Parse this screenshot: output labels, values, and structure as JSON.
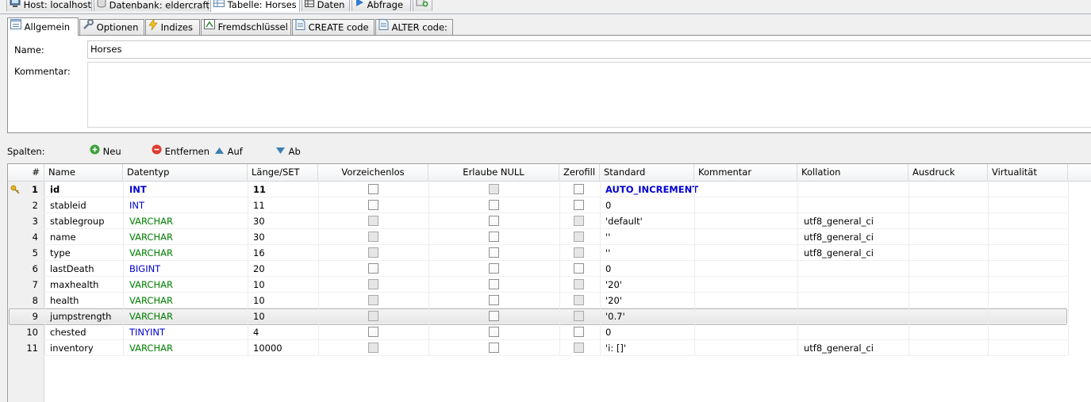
{
  "top_tabs": [
    {
      "label": "Host: localhost",
      "icon": "server-icon"
    },
    {
      "label": "Datenbank: eldercraft",
      "icon": "database-icon"
    },
    {
      "label": "Tabelle: Horses",
      "icon": "table-icon",
      "active": true
    },
    {
      "label": "Daten",
      "icon": "data-grid-icon"
    },
    {
      "label": "Abfrage",
      "icon": "play-query-icon"
    },
    {
      "label": "",
      "icon": "new-query-tab-icon"
    }
  ],
  "inner_tabs": [
    {
      "label": "Allgemein",
      "icon": "general-icon",
      "active": true
    },
    {
      "label": "Optionen",
      "icon": "wrench-icon"
    },
    {
      "label": "Indizes",
      "icon": "lightning-icon"
    },
    {
      "label": "Fremdschlüssel",
      "icon": "foreign-key-icon"
    },
    {
      "label": "CREATE code",
      "icon": "code-page-icon"
    },
    {
      "label": "ALTER code:",
      "icon": "code-page-icon"
    }
  ],
  "general": {
    "name_label": "Name:",
    "name_value": "Horses",
    "comment_label": "Kommentar:",
    "comment_value": ""
  },
  "columns_toolbar": {
    "label": "Spalten:",
    "new": "Neu",
    "remove": "Entfernen",
    "up": "Auf",
    "down": "Ab"
  },
  "grid": {
    "headers": [
      "#",
      "Name",
      "Datentyp",
      "Länge/SET",
      "Vorzeichenlos",
      "Erlaube NULL",
      "Zerofill",
      "Standard",
      "Kommentar",
      "Kollation",
      "Ausdruck",
      "Virtualität"
    ],
    "rows": [
      {
        "num": "1",
        "name": "id",
        "type": "INT",
        "length": "11",
        "unsigned": false,
        "allow_null": false,
        "zerofill": false,
        "default": "AUTO_INCREMENT",
        "comment": "",
        "collation": "",
        "primary_key": true
      },
      {
        "num": "2",
        "name": "stableid",
        "type": "INT",
        "length": "11",
        "unsigned": false,
        "allow_null": false,
        "zerofill": false,
        "default": "0",
        "comment": "",
        "collation": ""
      },
      {
        "num": "3",
        "name": "stablegroup",
        "type": "VARCHAR",
        "length": "30",
        "unsigned": false,
        "allow_null": false,
        "zerofill": false,
        "default": "'default'",
        "comment": "",
        "collation": "utf8_general_ci"
      },
      {
        "num": "4",
        "name": "name",
        "type": "VARCHAR",
        "length": "30",
        "unsigned": false,
        "allow_null": false,
        "zerofill": false,
        "default": "''",
        "comment": "",
        "collation": "utf8_general_ci"
      },
      {
        "num": "5",
        "name": "type",
        "type": "VARCHAR",
        "length": "16",
        "unsigned": false,
        "allow_null": false,
        "zerofill": false,
        "default": "''",
        "comment": "",
        "collation": "utf8_general_ci"
      },
      {
        "num": "6",
        "name": "lastDeath",
        "type": "BIGINT",
        "length": "20",
        "unsigned": false,
        "allow_null": false,
        "zerofill": false,
        "default": "0",
        "comment": "",
        "collation": ""
      },
      {
        "num": "7",
        "name": "maxhealth",
        "type": "VARCHAR",
        "length": "10",
        "unsigned": false,
        "allow_null": false,
        "zerofill": false,
        "default": "'20'",
        "comment": "",
        "collation": ""
      },
      {
        "num": "8",
        "name": "health",
        "type": "VARCHAR",
        "length": "10",
        "unsigned": false,
        "allow_null": false,
        "zerofill": false,
        "default": "'20'",
        "comment": "",
        "collation": ""
      },
      {
        "num": "9",
        "name": "jumpstrength",
        "type": "VARCHAR",
        "length": "10",
        "unsigned": false,
        "allow_null": false,
        "zerofill": false,
        "default": "'0.7'",
        "comment": "",
        "collation": "",
        "selected": true
      },
      {
        "num": "10",
        "name": "chested",
        "type": "TINYINT",
        "length": "4",
        "unsigned": false,
        "allow_null": false,
        "zerofill": false,
        "default": "0",
        "comment": "",
        "collation": ""
      },
      {
        "num": "11",
        "name": "inventory",
        "type": "VARCHAR",
        "length": "10000",
        "unsigned": false,
        "allow_null": false,
        "zerofill": false,
        "default": "'i: []'",
        "comment": "",
        "collation": "utf8_general_ci"
      }
    ]
  },
  "colors": {
    "int_type": "#0000d0",
    "varchar_type": "#008000",
    "accent": "#3c7fb1"
  }
}
